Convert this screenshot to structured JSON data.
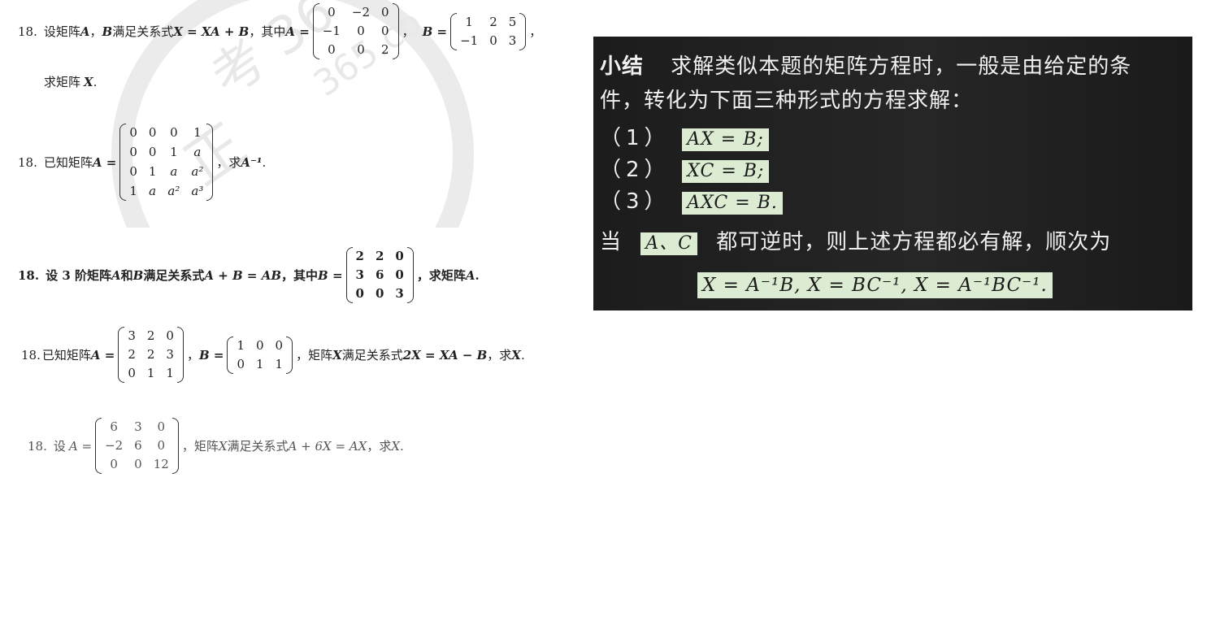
{
  "problems": [
    {
      "num": "18.",
      "pre": "设矩阵",
      "v1": "A",
      "sep": "，",
      "v2": "B",
      "mid": "满足关系式",
      "eq": "X = XA + B",
      "mid2": "，其中",
      "aname": "A =",
      "matrixA": [
        [
          "0",
          "−2",
          "0"
        ],
        [
          "−1",
          "0",
          "0"
        ],
        [
          "0",
          "0",
          "2"
        ]
      ],
      "comma": "，",
      "bname": "B =",
      "matrixB": [
        [
          "1",
          "2",
          "5"
        ],
        [
          "−1",
          "0",
          "3"
        ]
      ],
      "end": "，",
      "line2": "求矩阵",
      "line2v": "X",
      "line2end": "."
    },
    {
      "num": "18.",
      "pre": "已知矩阵",
      "aname": "A =",
      "matrix": [
        [
          "0",
          "0",
          "0",
          "1"
        ],
        [
          "0",
          "0",
          "1",
          "a"
        ],
        [
          "0",
          "1",
          "a",
          "a²"
        ],
        [
          "1",
          "a",
          "a²",
          "a³"
        ]
      ],
      "post": "，求",
      "target": "A⁻¹",
      "end": "."
    },
    {
      "num": "18.",
      "pre": "设 3 阶矩阵",
      "v1": "A",
      "and": "和",
      "v2": "B",
      "mid": "满足关系式",
      "eq": "A + B = AB",
      "mid2": "，其中",
      "bname": "B =",
      "matrix": [
        [
          "2",
          "2",
          "0"
        ],
        [
          "3",
          "6",
          "0"
        ],
        [
          "0",
          "0",
          "3"
        ]
      ],
      "post": "，求矩阵",
      "target": "A",
      "end": "."
    },
    {
      "num": "18.",
      "pre": "已知矩阵",
      "aname": "A =",
      "matrixA": [
        [
          "3",
          "2",
          "0"
        ],
        [
          "2",
          "2",
          "3"
        ],
        [
          "0",
          "1",
          "1"
        ]
      ],
      "comma": "，",
      "bname": "B =",
      "matrixB": [
        [
          "1",
          "0",
          "0"
        ],
        [
          "0",
          "1",
          "1"
        ]
      ],
      "mid": "，矩阵",
      "v": "X",
      "mid2": "满足关系式",
      "eq": "2X = XA − B",
      "post": "，求",
      "target": "X",
      "end": "."
    },
    {
      "num": "18.",
      "pre": "设",
      "aname": "A =",
      "matrix": [
        [
          "6",
          "3",
          "0"
        ],
        [
          "−2",
          "6",
          "0"
        ],
        [
          "0",
          "0",
          "12"
        ]
      ],
      "mid": "，矩阵",
      "v": "X",
      "mid2": "满足关系式",
      "eq": "A + 6X = AX",
      "post": "，求",
      "target": "X",
      "end": "."
    }
  ],
  "watermark": {
    "text1": "考 36",
    "text2": "365.co",
    "text3": "正"
  },
  "summary": {
    "heading": "小结",
    "line1": "求解类似本题的矩阵方程时，一般是由给定的条",
    "line2": "件，转化为下面三种形式的方程求解：",
    "items": [
      {
        "label": "（1）",
        "formula": "AX = B;"
      },
      {
        "label": "（2）",
        "formula": "XC = B;"
      },
      {
        "label": "（3）",
        "formula": "AXC = B."
      }
    ],
    "cond_pre": "当",
    "cond_vars": "A、C",
    "cond_post": "都可逆时，则上述方程都必有解，顺次为",
    "solution": "X = A⁻¹B, X = BC⁻¹, X = A⁻¹BC⁻¹."
  }
}
